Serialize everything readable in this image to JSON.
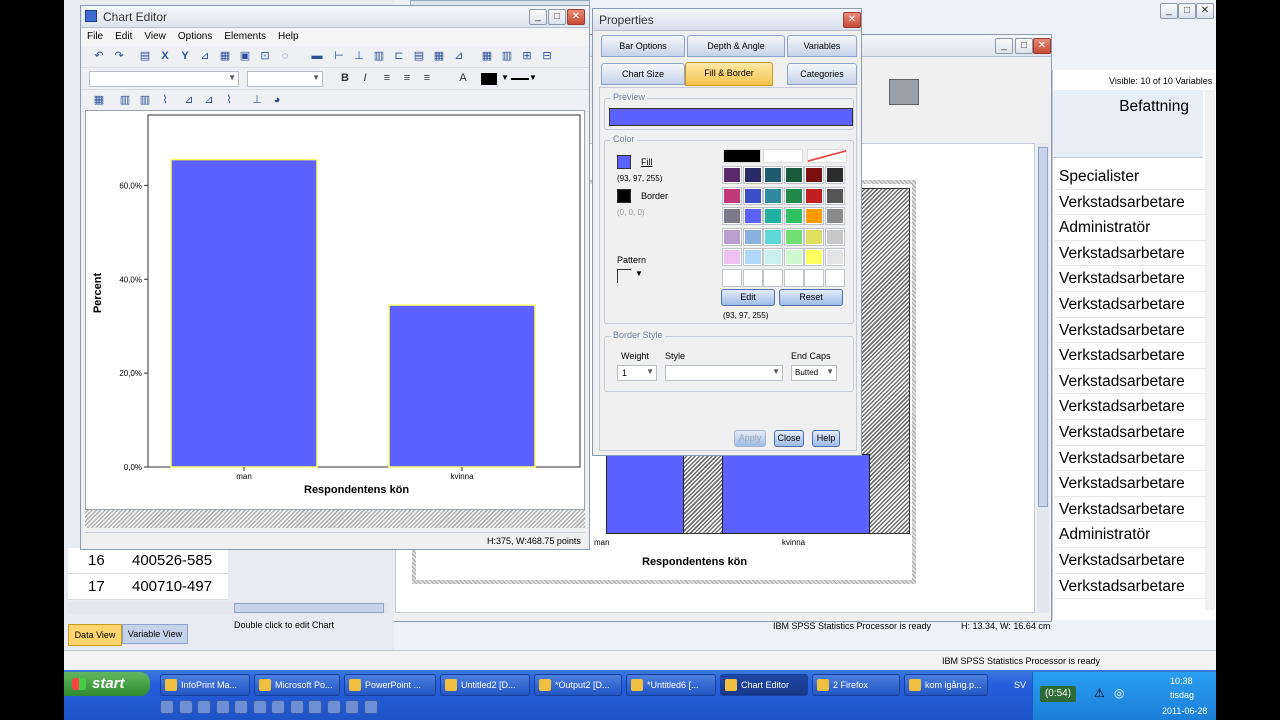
{
  "chart_editor": {
    "title": "Chart Editor",
    "menus": [
      "File",
      "Edit",
      "View",
      "Options",
      "Elements",
      "Help"
    ],
    "status_size": "H:375, W:468.75 points",
    "chart_data": {
      "type": "bar",
      "categories": [
        "man",
        "kvinna"
      ],
      "values": [
        65.5,
        34.5
      ],
      "ylabel": "Percent",
      "xlabel": "Respondentens kön",
      "ylim": [
        0,
        75
      ],
      "yticks": [
        "0,0%",
        "20,0%",
        "40,0%",
        "60,0%"
      ],
      "ytick_values": [
        0,
        20,
        40,
        60
      ],
      "bar_color": "#5d61ff",
      "bar_border": "#ffff66"
    }
  },
  "properties": {
    "title": "Properties",
    "tabs_row1": [
      "Bar Options",
      "Depth & Angle",
      "Variables"
    ],
    "tabs_row2": [
      "Chart Size",
      "Fill & Border",
      "Categories"
    ],
    "active_tab": "Fill & Border",
    "preview_label": "Preview",
    "preview_color": "#5d61ff",
    "color_label": "Color",
    "fill_label": "Fill",
    "fill_rgb": "(93, 97, 255)",
    "border_label": "Border",
    "border_rgb": "(0, 0, 0)",
    "pattern_label": "Pattern",
    "edit_button": "Edit",
    "reset_button": "Reset",
    "selected_rgb": "(93, 97, 255)",
    "border_style_label": "Border Style",
    "weight_label": "Weight",
    "weight_value": "1",
    "style_label": "Style",
    "end_caps_label": "End Caps",
    "end_caps_value": "Butted",
    "apply_button": "Apply",
    "close_button": "Close",
    "help_button": "Help",
    "palette": [
      [
        "#000000",
        "#ffffff",
        "#ffffff",
        "none"
      ],
      [
        "#5a2a6b",
        "#2a2a66",
        "#1f5b6e",
        "#1b5a3a",
        "#7a1010",
        "#2b2b2b"
      ],
      [
        "#c03a7a",
        "#3a4ec8",
        "#2e8a9e",
        "#1f8a4a",
        "#c0201f",
        "#555555"
      ],
      [
        "#7a7a8a",
        "#5d61ff",
        "#20b0a0",
        "#30c060",
        "#ff9a00",
        "#8a8a8a"
      ],
      [
        "#b9a0d0",
        "#8ab0e0",
        "#60d8d8",
        "#70e070",
        "#e0e060",
        "#c8c8c8"
      ],
      [
        "#f0c0f0",
        "#b0d8f8",
        "#c8f0f0",
        "#d0f8d0",
        "#ffff60",
        "#e4e4e4"
      ],
      [
        "#ffffff",
        "#ffffff",
        "#ffffff",
        "#ffffff",
        "#ffffff",
        "#ffffff"
      ]
    ]
  },
  "data_editor": {
    "tabs": [
      "Data View",
      "Variable View"
    ],
    "rows": [
      {
        "num": "16",
        "id": "400526-585"
      },
      {
        "num": "17",
        "id": "400710-497"
      }
    ],
    "status_left": "IBM SPSS Statistics Processor is ready"
  },
  "variables_window": {
    "visible_label": "Visible: 10 of 10 Variables",
    "column_header": "Befattning",
    "values": [
      "Specialister",
      "Verkstadsarbetare",
      "Administratör",
      "Verkstadsarbetare",
      "Verkstadsarbetare",
      "Verkstadsarbetare",
      "Verkstadsarbetare",
      "Verkstadsarbetare",
      "Verkstadsarbetare",
      "Verkstadsarbetare",
      "Verkstadsarbetare",
      "Verkstadsarbetare",
      "Verkstadsarbetare",
      "Verkstadsarbetare",
      "Administratör",
      "Verkstadsarbetare",
      "Verkstadsarbetare"
    ]
  },
  "output_window": {
    "xlabel": "Respondentens kön",
    "cat_left": "man",
    "cat_right": "kvinna",
    "status_hint": "Double click to edit Chart",
    "status_ready": "IBM SPSS Statistics Processor is ready",
    "status_size": "H: 13.34, W: 16.64 cm"
  },
  "taskbar": {
    "start": "start",
    "items": [
      "InfoPrint Ma...",
      "Microsoft Po...",
      "PowerPoint ...",
      "Untitled2 [D...",
      "*Output2 [D...",
      "*Untitled6 [...",
      "Chart Editor",
      "2 Firefox",
      "kom igång.p..."
    ],
    "lang": "SV",
    "timer": "(0:54)",
    "time": "10:38",
    "day": "tisdag",
    "date": "2011-06-28"
  }
}
